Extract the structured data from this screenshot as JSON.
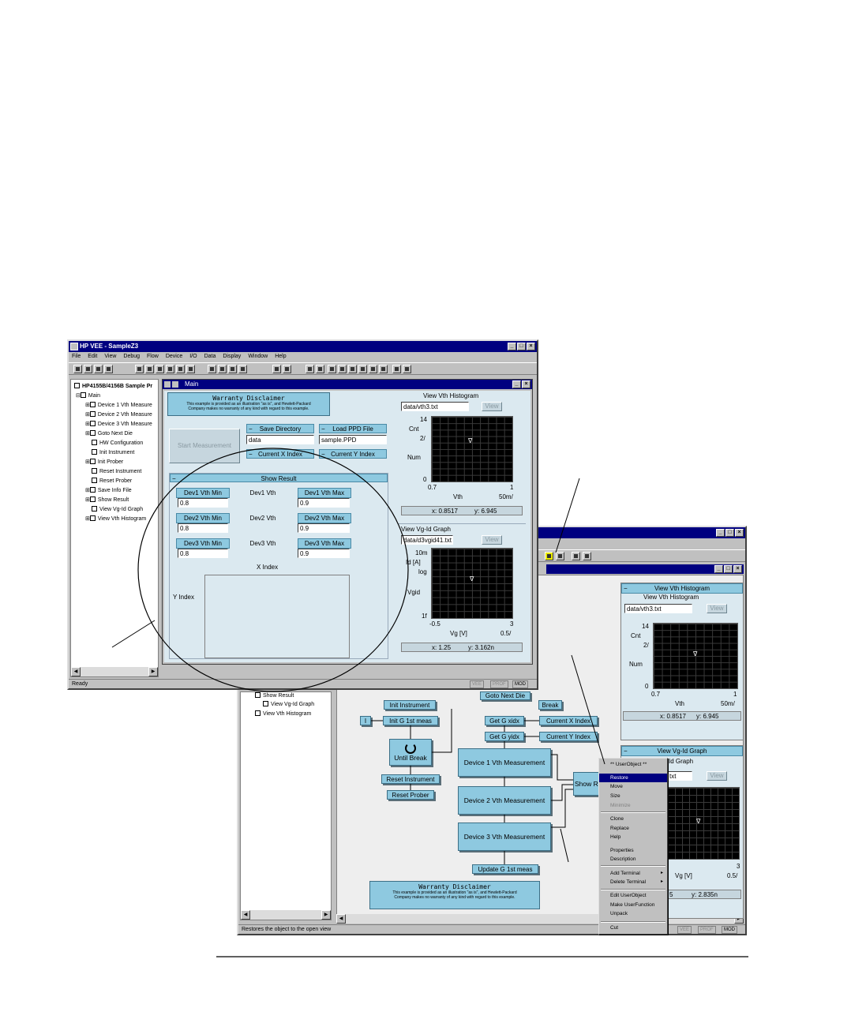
{
  "main_window": {
    "title": "HP VEE - SampleZ3",
    "menus": [
      "File",
      "Edit",
      "View",
      "Debug",
      "Flow",
      "Device",
      "I/O",
      "Data",
      "Display",
      "Window",
      "Help"
    ],
    "status": "Ready",
    "modes": [
      "VEE",
      "PROF",
      "MOD"
    ]
  },
  "tree": {
    "root": "HP4155B/4156B Sample Pr",
    "items": [
      "Main",
      "Device 1 Vth Measure",
      "Device 2 Vth Measure",
      "Device 3 Vth Measure",
      "Goto Next Die",
      "HW Configuration",
      "Init Instrument",
      "Init Prober",
      "Reset Instrument",
      "Reset Prober",
      "Save Info File",
      "Show Result",
      "View Vg-Id Graph",
      "View Vth Histogram"
    ]
  },
  "main_panel": {
    "title": "Main",
    "disclaimer_title": "Warranty Disclaimer",
    "disclaimer_text_1": "This example is provided as an illustration \"as is\", and Hewlett-Packard",
    "disclaimer_text_2": "Company makes no warranty of any kind with regard to this example.",
    "start_button": "Start Measurement",
    "save_dir_label": "Save Directory",
    "save_dir_value": "data",
    "load_ppd_label": "Load PPD File",
    "load_ppd_value": "sample.PPD",
    "current_x_label": "Current X Index",
    "current_y_label": "Current Y Index",
    "show_result_label": "Show Result",
    "dev_rows": [
      {
        "min_label": "Dev1 Vth Min",
        "min_value": "0.8",
        "vth_label": "Dev1 Vth",
        "max_label": "Dev1 Vth Max",
        "max_value": "0.9"
      },
      {
        "min_label": "Dev2 Vth Min",
        "min_value": "0.8",
        "vth_label": "Dev2 Vth",
        "max_label": "Dev2 Vth Max",
        "max_value": "0.9"
      },
      {
        "min_label": "Dev3 Vth Min",
        "min_value": "0.8",
        "vth_label": "Dev3 Vth",
        "max_label": "Dev3 Vth Max",
        "max_value": "0.9"
      }
    ],
    "x_index_label": "X Index",
    "y_index_label": "Y Index"
  },
  "histogram": {
    "title": "View Vth Histogram",
    "file": "data/vth3.txt",
    "view_button": "View",
    "y_top": "14",
    "y_label": "Cnt",
    "y_mid": "2/",
    "series": "Num",
    "y_bottom": "0",
    "x_left": "0.7",
    "x_label": "Vth",
    "x_right": "1",
    "x_scale": "50m/",
    "readout_x": "x: 0.8517",
    "readout_y": "y: 6.945",
    "marker": "∇"
  },
  "vgid": {
    "title": "View Vg-Id Graph",
    "file": "data/d3vgid41.txt",
    "view_button": "View",
    "y_top": "10m",
    "y_label": "Id [A]",
    "y_log": "log",
    "series": "Vgid",
    "y_bottom": "1f",
    "x_left": "-0.5",
    "x_label": "Vg [V]",
    "x_right": "3",
    "x_scale": "0.5/",
    "readout_x": "x: 1.25",
    "readout_y": "y: 3.162n",
    "marker": "∇"
  },
  "back_window": {
    "tree_items": [
      "Show Result",
      "View Vg-Id Graph",
      "View Vth Histogram"
    ],
    "status": "Restores the object to the open view",
    "modes": [
      "VEE",
      "PROF",
      "MOD"
    ],
    "nodes": {
      "goto_next_die": "Goto Next Die",
      "break": "Break",
      "init_instrument": "Init Instrument",
      "init_g": "Init G  1st  meas",
      "get_xidx": "Get G  xidx",
      "get_yidx": "Get G  yidx",
      "current_x": "Current X Index",
      "current_y": "Current Y Index",
      "until_break": "Until Break",
      "reset_instrument": "Reset Instrument",
      "reset_prober": "Reset Prober",
      "dev1": "Device 1 Vth Measurement",
      "dev2": "Device 2 Vth Measurement",
      "dev3": "Device 3 Vth Measurement",
      "show_r": "Show R",
      "update_g": "Update G  1st  meas"
    },
    "disclaimer_title": "Warranty Disclaimer",
    "disclaimer_text_1": "This example is provided as an illustration \"as is\", and Hewlett-Packard",
    "disclaimer_text_2": "Company makes no warranty of any kind with regard to this example.",
    "hist_title": "View Vth Histogram",
    "hist_sub": "View Vth Histogram",
    "hist_file": "data/vth3.txt",
    "hist_view": "View",
    "hist_y_top": "14",
    "hist_y_label": "Cnt",
    "hist_y_mid": "2/",
    "hist_series": "Num",
    "hist_y_bottom": "0",
    "hist_x_left": "0.7",
    "hist_x_label": "Vth",
    "hist_x_right": "1",
    "hist_x_scale": "50m/",
    "hist_readout_x": "x: 0.8517",
    "hist_readout_y": "y: 6.945",
    "vgid_title": "View Vg-Id Graph",
    "vgid_sub": "Id Graph",
    "vgid_file": "txt",
    "vgid_view": "View",
    "vgid_x_right": "3",
    "vgid_x_label": "Vg [V]",
    "vgid_x_scale": "0.5/",
    "vgid_readout_x": "5",
    "vgid_readout_y": "y: 2.835n"
  },
  "context_menu": {
    "title": "** UserObject **",
    "items": [
      "Restore",
      "Move",
      "Size",
      "Minimize",
      "Clone",
      "Replace",
      "Help",
      "Properties",
      "Description",
      "Add Terminal",
      "Delete Terminal",
      "Edit UserObject",
      "Make UserFunction",
      "Unpack",
      "Cut"
    ]
  }
}
